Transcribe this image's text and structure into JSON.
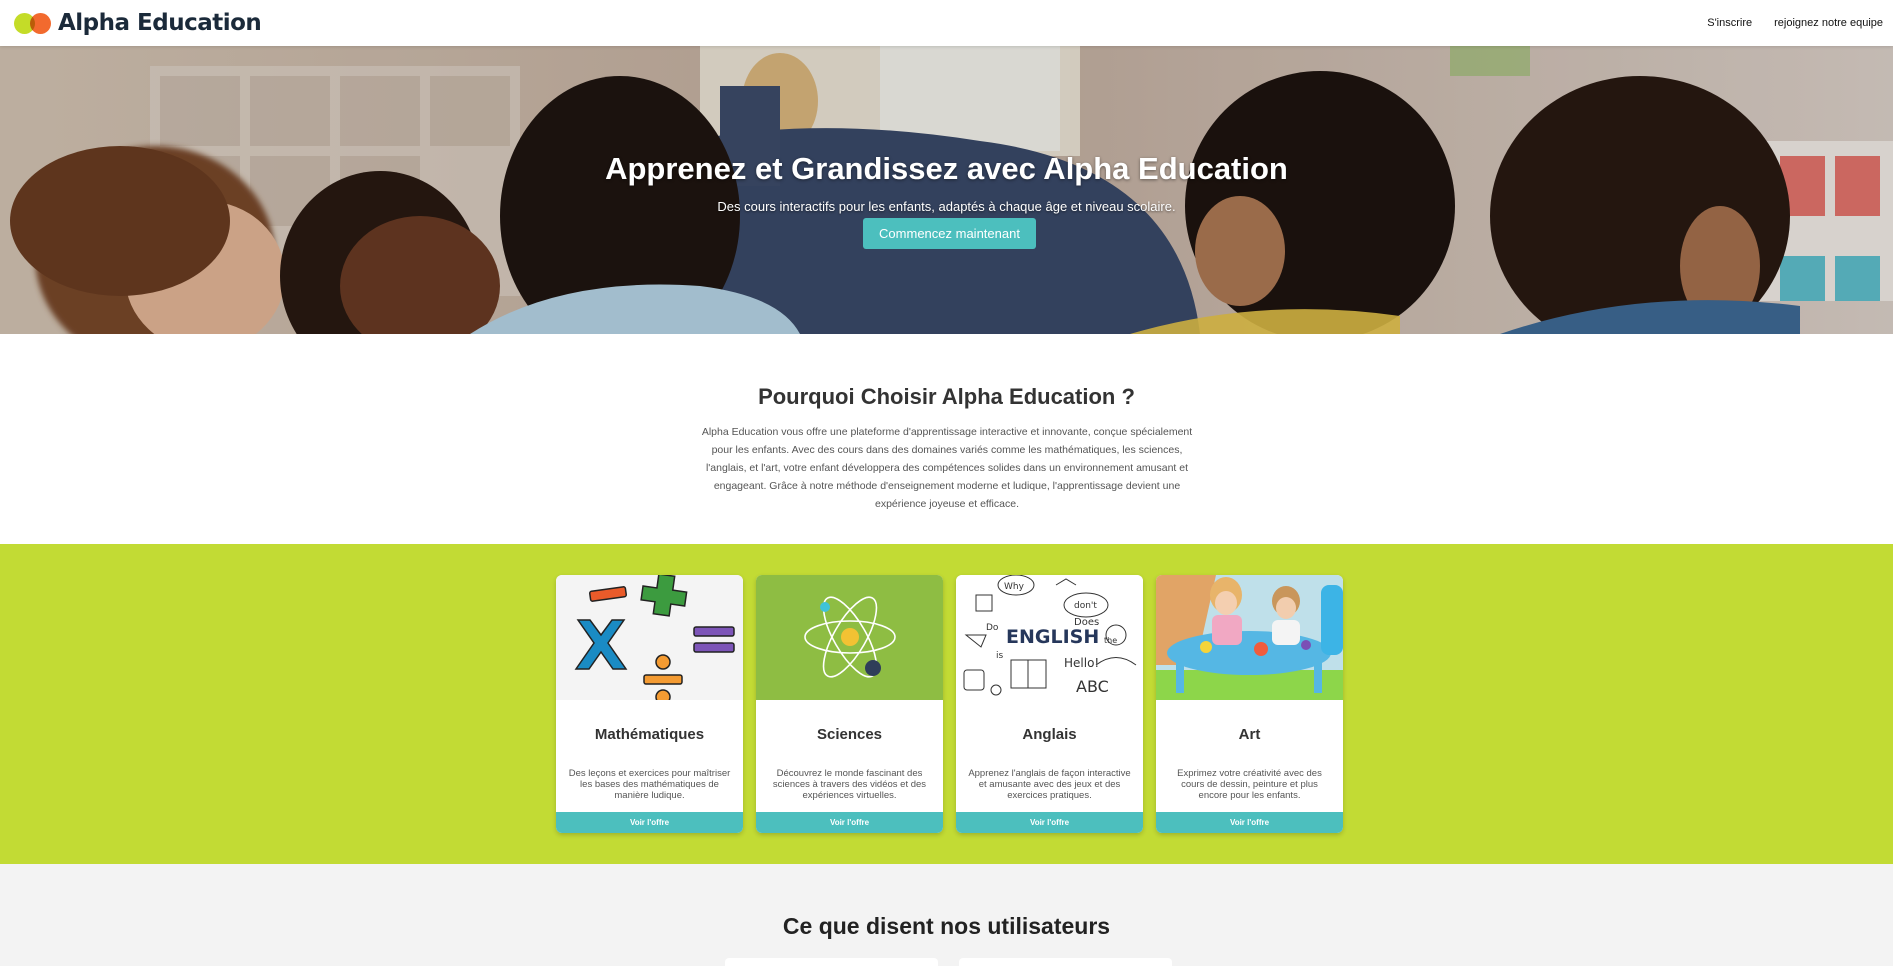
{
  "header": {
    "brand": "Alpha Education",
    "nav": [
      {
        "label": "S'inscrire"
      },
      {
        "label": "rejoignez notre equipe"
      }
    ]
  },
  "hero": {
    "title": "Apprenez et Grandissez avec Alpha Education",
    "subtitle": "Des cours interactifs pour les enfants, adaptés à chaque âge et niveau scolaire.",
    "cta_label": "Commencez maintenant"
  },
  "why": {
    "title": "Pourquoi Choisir Alpha Education ?",
    "text": "Alpha Education vous offre une plateforme d'apprentissage interactive et innovante, conçue spécialement pour les enfants. Avec des cours dans des domaines variés comme les mathématiques, les sciences, l'anglais, et l'art, votre enfant développera des compétences solides dans un environnement amusant et engageant. Grâce à notre méthode d'enseignement moderne et ludique, l'apprentissage devient une expérience joyeuse et efficace."
  },
  "courses": [
    {
      "title": "Mathématiques",
      "description": "Des leçons et exercices pour maîtriser les bases des mathématiques de manière ludique.",
      "button": "Voir l'offre"
    },
    {
      "title": "Sciences",
      "description": "Découvrez le monde fascinant des sciences à travers des vidéos et des expériences virtuelles.",
      "button": "Voir l'offre"
    },
    {
      "title": "Anglais",
      "description": "Apprenez l'anglais de façon interactive et amusante avec des jeux et des exercices pratiques.",
      "button": "Voir l'offre"
    },
    {
      "title": "Art",
      "description": "Exprimez votre créativité avec des cours de dessin, peinture et plus encore pour les enfants.",
      "button": "Voir l'offre"
    }
  ],
  "english_art": {
    "word": "ENGLISH",
    "words": [
      "Why",
      "don't",
      "Does",
      "Do",
      "is",
      "the",
      "Hello!",
      "ABC"
    ]
  },
  "testimonials": {
    "title": "Ce que disent nos utilisateurs"
  },
  "colors": {
    "accent": "#4cbfbe",
    "lime": "#c2db34",
    "logo_green": "#c4dc28",
    "logo_orange": "#f26a2e"
  }
}
